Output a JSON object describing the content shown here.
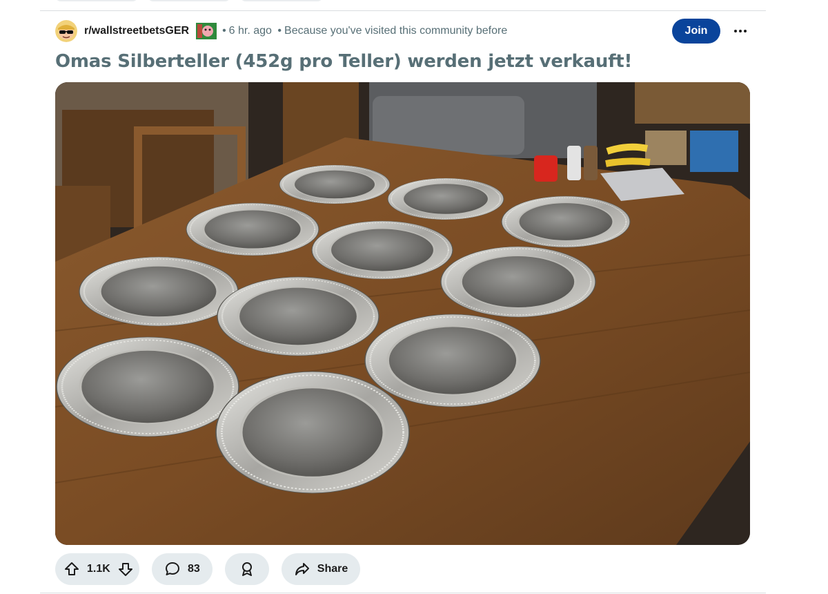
{
  "post": {
    "subreddit": "r/wallstreetbetsGER",
    "time_ago": "6 hr. ago",
    "reason": "Because you've visited this community before",
    "join_label": "Join",
    "title": "Omas Silberteller (452g pro Teller) werden jetzt verkauft!",
    "image_subject": "ten silver plates on a wooden dining table"
  },
  "actions": {
    "score": "1.1K",
    "comments": "83",
    "share_label": "Share"
  },
  "icons": [
    "snoo-avatar-icon",
    "flair-icon",
    "more-icon",
    "upvote-icon",
    "downvote-icon",
    "comment-icon",
    "award-icon",
    "share-icon"
  ],
  "colors": {
    "join": "#0a449b",
    "pill": "#e5ebee",
    "meta": "#576f76"
  }
}
